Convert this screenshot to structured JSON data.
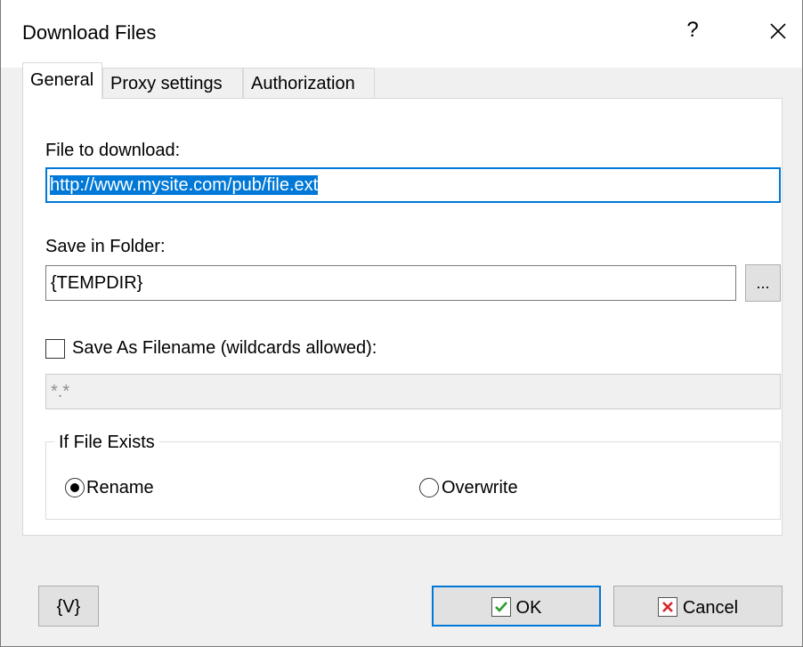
{
  "window": {
    "title": "Download Files",
    "help_label": "?",
    "close_icon": "close-icon"
  },
  "tabs": [
    {
      "label": "General",
      "active": true
    },
    {
      "label": "Proxy settings",
      "active": false
    },
    {
      "label": "Authorization",
      "active": false
    }
  ],
  "general": {
    "file_label": "File to download:",
    "file_value": "http://www.mysite.com/pub/file.ext",
    "folder_label": "Save in Folder:",
    "folder_value": "{TEMPDIR}",
    "browse_label": "...",
    "save_as_label": "Save As Filename (wildcards allowed):",
    "save_as_checked": false,
    "save_as_value": "*.*",
    "exists_group_label": "If File Exists",
    "rename_label": "Rename",
    "overwrite_label": "Overwrite",
    "selected_option": "Rename"
  },
  "footer": {
    "variables_label": "{V}",
    "ok_label": "OK",
    "cancel_label": "Cancel"
  },
  "colors": {
    "accent": "#0078d7",
    "ok_check": "#2a9d2a",
    "cancel_x": "#d7262c"
  }
}
